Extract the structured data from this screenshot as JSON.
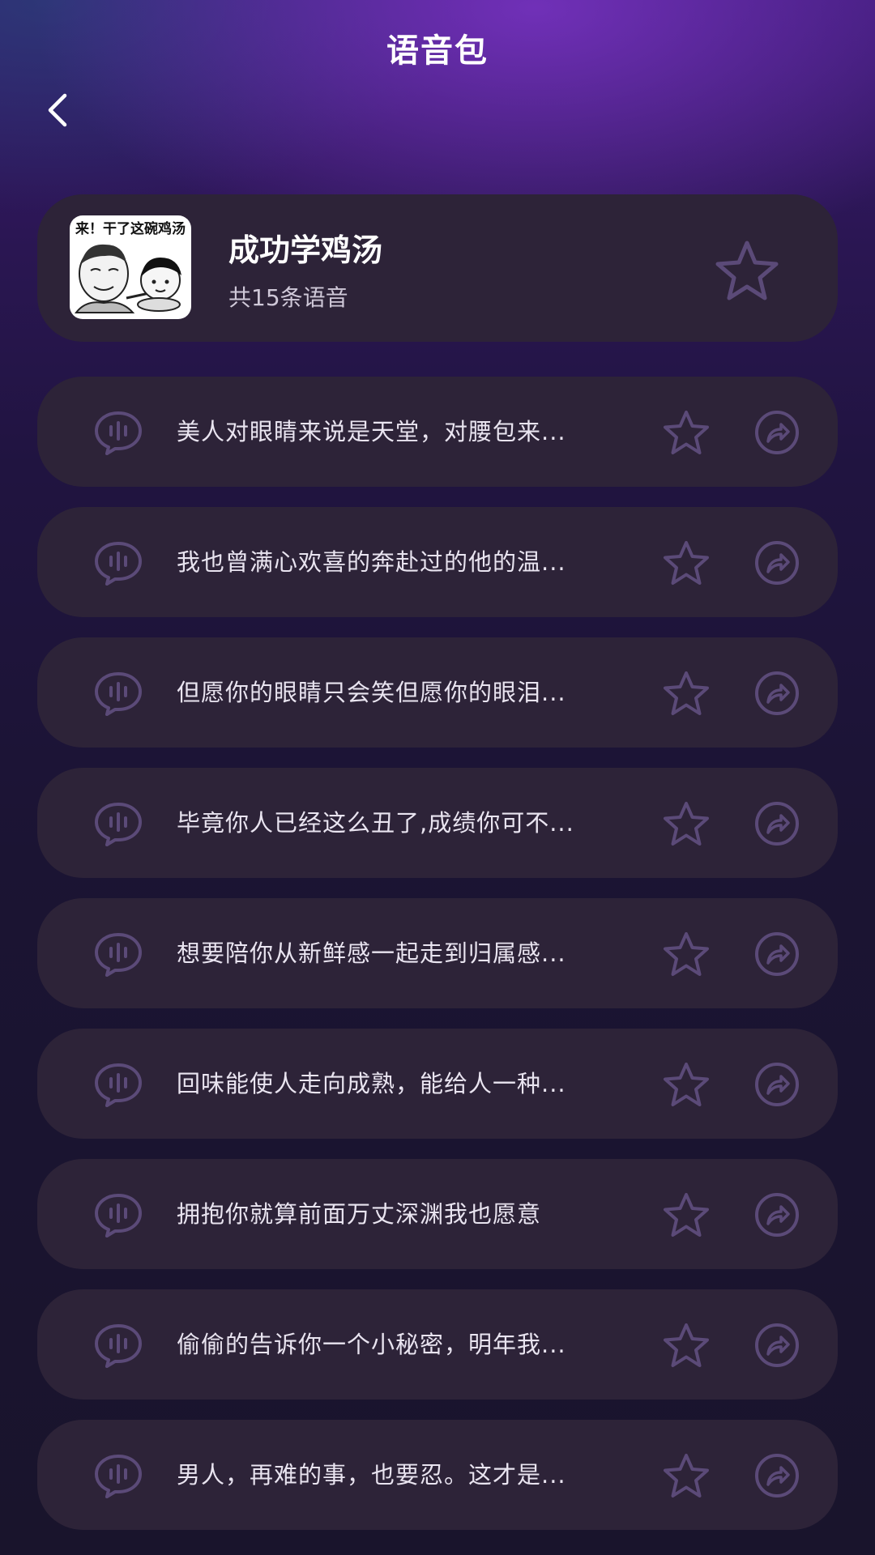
{
  "header": {
    "title": "语音包",
    "back_icon": "chevron-left-icon"
  },
  "pack": {
    "cover_caption": "来！干了这碗鸡汤",
    "cover_sub": "鸡汤",
    "name": "成功学鸡汤",
    "count_text": "共15条语音",
    "favorite_icon": "star-outline-icon"
  },
  "colors": {
    "card_bg": "#2d2338",
    "icon_stroke": "#5b4a78",
    "text": "#e9e4f0",
    "subtext": "#cfc8d8"
  },
  "voices": [
    {
      "text": "美人对眼睛来说是天堂，对腰包来..."
    },
    {
      "text": "我也曾满心欢喜的奔赴过的他的温..."
    },
    {
      "text": "但愿你的眼睛只会笑但愿你的眼泪..."
    },
    {
      "text": "毕竟你人已经这么丑了,成绩你可不..."
    },
    {
      "text": "想要陪你从新鲜感一起走到归属感..."
    },
    {
      "text": "回味能使人走向成熟，能给人一种..."
    },
    {
      "text": "拥抱你就算前面万丈深渊我也愿意"
    },
    {
      "text": "偷偷的告诉你一个小秘密，明年我..."
    },
    {
      "text": "男人，再难的事，也要忍。这才是..."
    }
  ],
  "voice_icons": {
    "play": "voice-bubble-icon",
    "favorite": "star-outline-icon",
    "share": "share-icon"
  }
}
